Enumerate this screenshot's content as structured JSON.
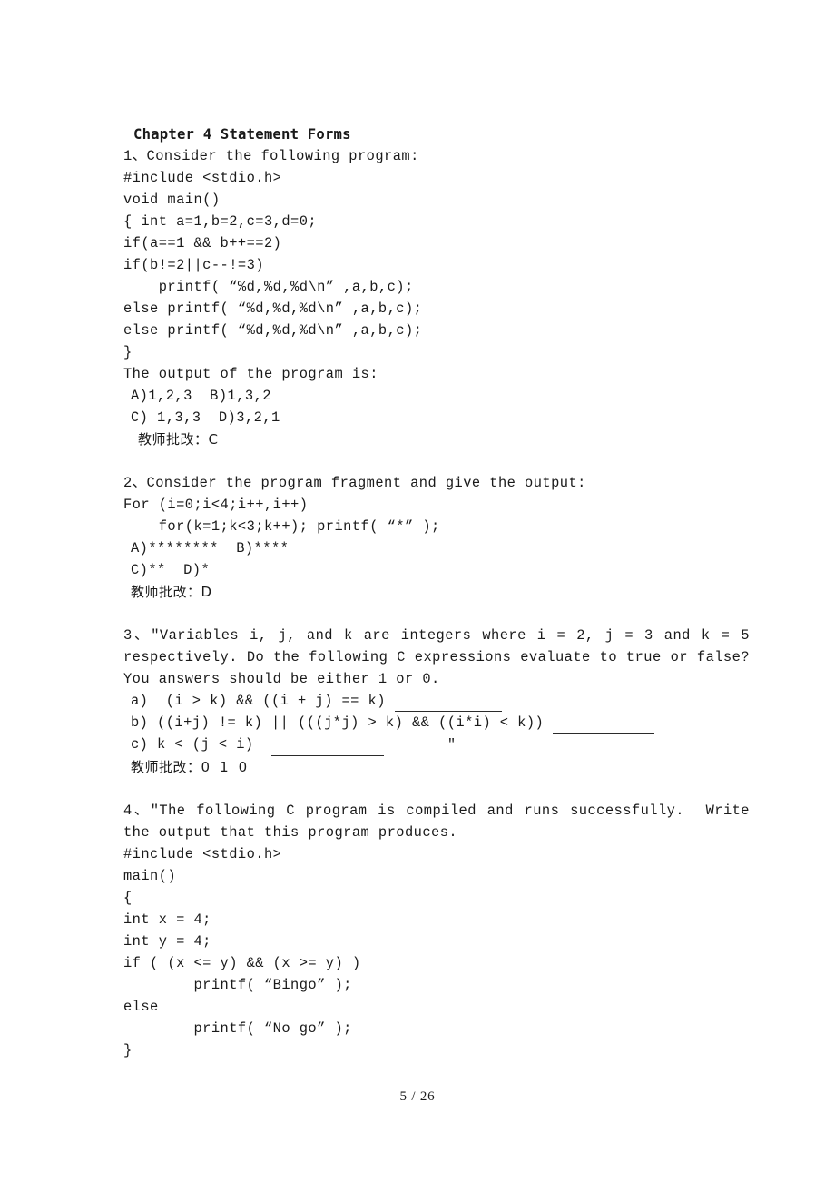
{
  "document": {
    "heading": "Chapter 4 Statement Forms",
    "footer": "5 / 26"
  },
  "questions": [
    {
      "number": "1、",
      "prompt": "1、Consider the following program:",
      "code": [
        "#include <stdio.h>",
        "void main()",
        "{ int a=1,b=2,c=3,d=0;",
        "if(a==1 && b++==2)",
        "if(b!=2||c--!=3)",
        "    printf( “%d,%d,%d\\n” ,a,b,c);",
        "else printf( “%d,%d,%d\\n” ,a,b,c);",
        "else printf( “%d,%d,%d\\n” ,a,b,c);",
        "}"
      ],
      "question_line": "The output of the program is:",
      "options_line_1": "A)1,2,3  B)1,3,2",
      "options_line_2": "C) 1,3,3  D)3,2,1",
      "teacher_note": "教师批改：C"
    },
    {
      "number": "2、",
      "prompt": "2、Consider the program fragment and give the output:",
      "code": [
        "For (i=0;i<4;i++,i++)",
        "    for(k=1;k<3;k++); printf( “*” );"
      ],
      "options_line_1": "A)********  B)****",
      "options_line_2": "C)**  D)*",
      "teacher_note": "教师批改：D"
    },
    {
      "number": "3、",
      "prompt": "3、″Variables i, j, and k are integers where i = 2, j = 3 and k = 5 respectively. Do the following C expressions evaluate to true or false? You answers should be either 1 or 0.",
      "sub_items": [
        {
          "label": "a)",
          "expression": "  (i > k) && ((i + j) == k)"
        },
        {
          "label": "b)",
          "expression": " ((i+j) != k) || (((j*j) > k) && ((i*i) < k))"
        },
        {
          "label": "c)",
          "expression": " k < (j < i)"
        }
      ],
      "trailing_quote": "″",
      "teacher_note": "教师批改：0  1  0"
    },
    {
      "number": "4、",
      "prompt": "4、″The following C program is compiled and runs successfully.  Write the output that this program produces.",
      "code": [
        "#include <stdio.h>",
        "main()",
        "{",
        "int x = 4;",
        "int y = 4;",
        "if ( (x <= y) && (x >= y) )",
        "        printf( “Bingo” );",
        "else",
        "        printf( “No go” );",
        "}"
      ]
    }
  ]
}
